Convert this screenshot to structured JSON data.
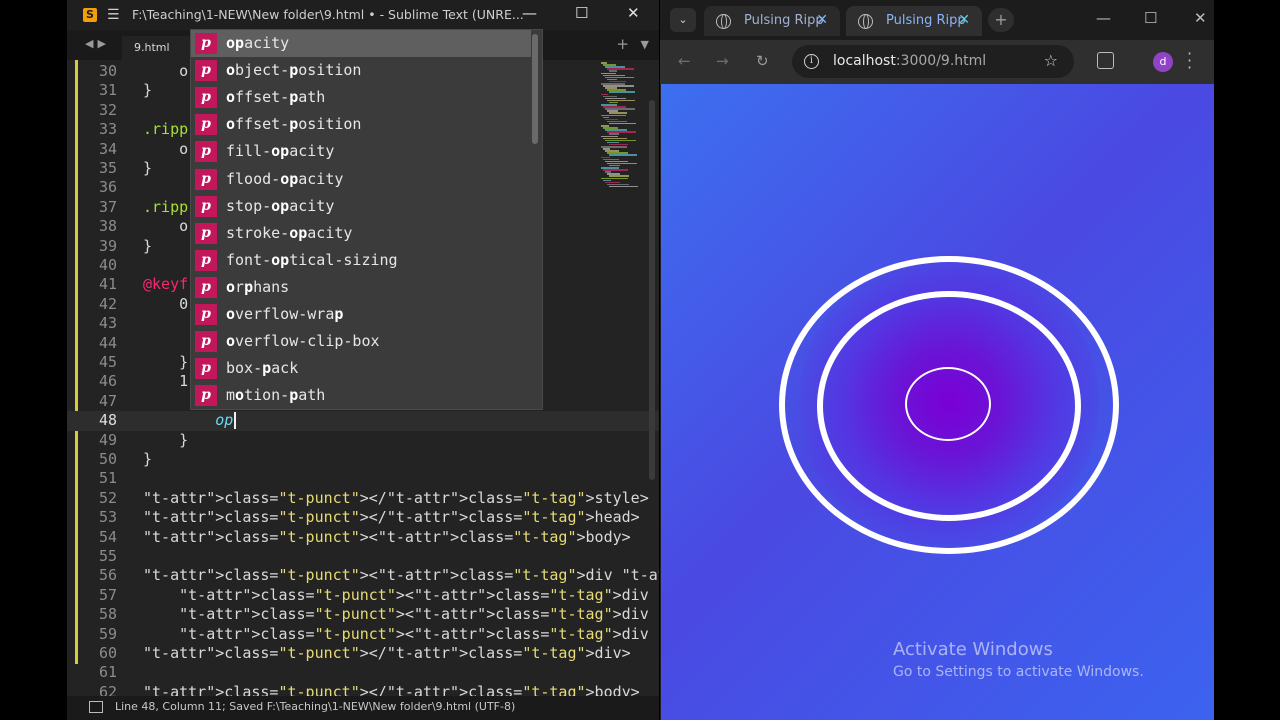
{
  "sublime": {
    "title": "F:\\Teaching\\1-NEW\\New folder\\9.html • - Sublime Text (UNRE...",
    "menu_icon": "hamburger-icon",
    "logo": "S",
    "window_controls": [
      "—",
      "☐",
      "✕"
    ],
    "tab_label": "9.html",
    "nav_arrows": "◀▶",
    "tab_plus": "+",
    "tab_dropdown": "▼",
    "status": "Line 48, Column 11; Saved F:\\Teaching\\1-NEW\\New folder\\9.html (UTF-8)",
    "code_lines": [
      {
        "n": "30",
        "text": "    o"
      },
      {
        "n": "31",
        "text": "}"
      },
      {
        "n": "32",
        "text": ""
      },
      {
        "n": "33",
        "text": ".ripp"
      },
      {
        "n": "34",
        "text": "    o"
      },
      {
        "n": "35",
        "text": "}"
      },
      {
        "n": "36",
        "text": ""
      },
      {
        "n": "37",
        "text": ".ripp"
      },
      {
        "n": "38",
        "text": "    o"
      },
      {
        "n": "39",
        "text": "}"
      },
      {
        "n": "40",
        "text": ""
      },
      {
        "n": "41",
        "text": "@keyf"
      },
      {
        "n": "42",
        "text": "    0"
      },
      {
        "n": "43",
        "text": ""
      },
      {
        "n": "44",
        "text": ""
      },
      {
        "n": "45",
        "text": "    }"
      },
      {
        "n": "46",
        "text": "    1"
      },
      {
        "n": "47",
        "text": ""
      },
      {
        "n": "48",
        "text": "        op"
      },
      {
        "n": "49",
        "text": "    }"
      },
      {
        "n": "50",
        "text": "}"
      },
      {
        "n": "51",
        "text": ""
      },
      {
        "n": "52",
        "text": "</style>"
      },
      {
        "n": "53",
        "text": "</head>"
      },
      {
        "n": "54",
        "text": "<body>"
      },
      {
        "n": "55",
        "text": ""
      },
      {
        "n": "56",
        "text": "<div class=\"loader-container\">"
      },
      {
        "n": "57",
        "text": "    <div class=\"ripple\"></div>"
      },
      {
        "n": "58",
        "text": "    <div class=\"ripple\"></div>"
      },
      {
        "n": "59",
        "text": "    <div class=\"ripple\"></div>"
      },
      {
        "n": "60",
        "text": "</div>"
      },
      {
        "n": "61",
        "text": ""
      },
      {
        "n": "62",
        "text": "</body>"
      }
    ],
    "autocomplete": {
      "badge": "p",
      "items": [
        {
          "pre": "",
          "match": "op",
          "post": "acity"
        },
        {
          "pre": "",
          "match": "o",
          "post": "bject-"
        },
        {
          "pre": "",
          "match": "p",
          "post": "osition"
        },
        {
          "pre": "",
          "match": "o",
          "post": "ffset-"
        },
        {
          "pre": "",
          "match": "p",
          "post": "ath"
        },
        {
          "pre": "",
          "match": "o",
          "post": "ffset-"
        },
        {
          "pre": "",
          "match": "p",
          "post": "osition"
        },
        {
          "pre": "fill-",
          "match": "op",
          "post": "acity"
        },
        {
          "pre": "flood-",
          "match": "op",
          "post": "acity"
        },
        {
          "pre": "stop-",
          "match": "op",
          "post": "acity"
        },
        {
          "pre": "stroke-",
          "match": "op",
          "post": "acity"
        },
        {
          "pre": "font-",
          "match": "op",
          "post": "tical-sizing"
        },
        {
          "pre": "",
          "match": "o",
          "post": "r"
        },
        {
          "pre": "",
          "match": "p",
          "post": "hans"
        },
        {
          "pre": "",
          "match": "o",
          "post": "verflow-wra"
        },
        {
          "pre": "",
          "match": "p",
          "post": ""
        },
        {
          "pre": "",
          "match": "o",
          "post": "verflow-clip-box"
        },
        {
          "pre": "b",
          "match": "o",
          "post": "x-"
        },
        {
          "pre": "",
          "match": "p",
          "post": "ack"
        },
        {
          "pre": "m",
          "match": "o",
          "post": "tion-"
        },
        {
          "pre": "",
          "match": "p",
          "post": "ath"
        }
      ]
    }
  },
  "browser": {
    "tabs": [
      {
        "label": "Pulsing Ripp",
        "icon": "globe-icon",
        "close": "✕"
      },
      {
        "label": "Pulsing Ripp",
        "icon": "globe-icon",
        "close": "✕"
      }
    ],
    "tab_search": "⌄",
    "new_tab": "+",
    "window_controls": [
      "—",
      "☐",
      "✕"
    ],
    "nav": [
      "←",
      "→",
      "↻"
    ],
    "url_host": "localhost",
    "url_path": ":3000/9.html",
    "avatar_letter": "d",
    "bookmark": "☆",
    "watermark_line1": "Activate Windows",
    "watermark_line2": "Go to Settings to activate Windows.",
    "colors": {
      "bg_start": "#3d6ff0",
      "bg_mid": "#4a49e2",
      "glow": "#7a00d6",
      "ring": "#ffffff"
    }
  }
}
